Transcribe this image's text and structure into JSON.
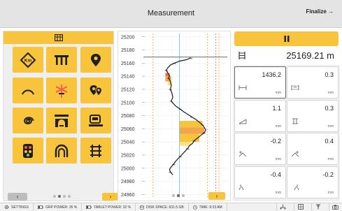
{
  "header": {
    "title": "Measurement",
    "finalize_label": "Finalize →"
  },
  "left_panel": {
    "header_icon": "grid-table-icon",
    "tiles": [
      {
        "name": "km-marker-tile",
        "icon": "km-diamond-icon",
        "text": "Km"
      },
      {
        "name": "bridge-tile",
        "icon": "bridge-icon"
      },
      {
        "name": "location-pin-tile",
        "icon": "location-pin-icon"
      },
      {
        "name": "curve-tile",
        "icon": "curve-arc-icon"
      },
      {
        "name": "level-crossing-tile",
        "icon": "level-crossing-icon"
      },
      {
        "name": "multiple-pins-tile",
        "icon": "multiple-pins-icon"
      },
      {
        "name": "spiral-tile",
        "icon": "spiral-icon"
      },
      {
        "name": "tunnel-portal-tile",
        "icon": "tunnel-portal-icon"
      },
      {
        "name": "platform-tile",
        "icon": "platform-icon"
      },
      {
        "name": "signal-tile",
        "icon": "signal-icon"
      },
      {
        "name": "tunnel-tile",
        "icon": "tunnel-arch-icon"
      },
      {
        "name": "track-tile",
        "icon": "track-ties-icon"
      }
    ],
    "prev_label": "‹",
    "next_label": "›",
    "page_dots": 4,
    "active_dot": 1
  },
  "chart_data": {
    "type": "line",
    "y_ticks": [
      "25200",
      "25180",
      "25160",
      "25140",
      "25120",
      "25100",
      "25080",
      "25060",
      "25040",
      "25020",
      "25000",
      "24980",
      "24960"
    ],
    "ylim": [
      24955,
      25205
    ],
    "x_range": [
      0,
      100
    ],
    "current_position": 25169.21,
    "series": [
      {
        "points": [
          [
            56,
            25168
          ],
          [
            50,
            25165
          ],
          [
            42,
            25163
          ],
          [
            36,
            25160
          ],
          [
            31,
            25157
          ],
          [
            28,
            25153
          ],
          [
            26,
            25149
          ],
          [
            28,
            25145
          ],
          [
            30,
            25141
          ],
          [
            29,
            25137
          ],
          [
            31,
            25132
          ],
          [
            32,
            25126
          ],
          [
            31,
            25120
          ],
          [
            33,
            25114
          ],
          [
            34,
            25108
          ],
          [
            32,
            25102
          ],
          [
            35,
            25098
          ],
          [
            38,
            25094
          ],
          [
            43,
            25090
          ],
          [
            47,
            25086
          ],
          [
            52,
            25082
          ],
          [
            57,
            25078
          ],
          [
            62,
            25074
          ],
          [
            66,
            25070
          ],
          [
            70,
            25066
          ],
          [
            72,
            25062
          ],
          [
            74,
            25058
          ],
          [
            72,
            25054
          ],
          [
            68,
            25050
          ],
          [
            64,
            25046
          ],
          [
            60,
            25042
          ],
          [
            58,
            25038
          ],
          [
            54,
            25034
          ],
          [
            52,
            25030
          ],
          [
            49,
            25026
          ],
          [
            46,
            25022
          ],
          [
            43,
            25018
          ],
          [
            40,
            25014
          ],
          [
            37,
            25010
          ],
          [
            35,
            25006
          ],
          [
            32,
            25002
          ],
          [
            30,
            24998
          ],
          [
            31,
            24994
          ],
          [
            34,
            24990
          ]
        ]
      }
    ],
    "bands": [
      {
        "y0": 25145,
        "y1": 25140,
        "x0": 25,
        "x1": 30,
        "color": "#f4694a"
      },
      {
        "y0": 25140,
        "y1": 25132,
        "x0": 25,
        "x1": 32,
        "color": "#f7a24a"
      },
      {
        "y0": 25132,
        "y1": 25126,
        "x0": 28,
        "x1": 33,
        "color": "#fbe08a"
      },
      {
        "y0": 25072,
        "y1": 25062,
        "x0": 42,
        "x1": 70,
        "color": "#f7c43c"
      },
      {
        "y0": 25062,
        "y1": 25052,
        "x0": 42,
        "x1": 72,
        "color": "#f4a54a"
      },
      {
        "y0": 25052,
        "y1": 25040,
        "x0": 42,
        "x1": 66,
        "color": "#f7c43c"
      },
      {
        "y0": 25040,
        "y1": 25034,
        "x0": 42,
        "x1": 56,
        "color": "#fbe08a"
      }
    ],
    "ref_lines": [
      {
        "x": 10,
        "color": "#f0a030"
      },
      {
        "x": 42,
        "color": "#6ec0d0"
      },
      {
        "x": 76,
        "color": "#f0a030"
      },
      {
        "x": 86,
        "color": "#f07050"
      },
      {
        "x": 90,
        "color": "#f0a030"
      }
    ],
    "grid": true,
    "next_label": "›",
    "page_dots": 3,
    "active_dot": 1
  },
  "right_panel": {
    "pause_icon": "pause-icon",
    "position_icon": "rail-track-icon",
    "position_value": "25169.21 m",
    "cards": [
      {
        "name": "gauge-card",
        "value": "1436.2",
        "unit": "mm",
        "icon": "gauge-width-icon",
        "active": true
      },
      {
        "name": "gauge-deviation-card",
        "value": "0.3",
        "unit": "mm",
        "icon": "gauge-deviation-icon",
        "active": false
      },
      {
        "name": "cant-card",
        "value": "1.1",
        "unit": "mm",
        "icon": "cant-icon",
        "active": false
      },
      {
        "name": "twist-card",
        "value": "0.3",
        "unit": "mm",
        "icon": "twist-icon",
        "active": false
      },
      {
        "name": "alignment-left-card",
        "value": "-0.2",
        "unit": "mm",
        "icon": "alignment-left-icon",
        "active": false
      },
      {
        "name": "alignment-right-card",
        "value": "0.4",
        "unit": "mm",
        "icon": "alignment-right-icon",
        "active": false
      },
      {
        "name": "level-left-card",
        "value": "-0.4",
        "unit": "mm",
        "icon": "level-left-icon",
        "active": false
      },
      {
        "name": "level-right-card",
        "value": "-0.2",
        "unit": "mm",
        "icon": "level-right-icon",
        "active": false
      }
    ]
  },
  "status_bar": {
    "settings": "SETTINGS",
    "grp_power": "GRP POWER: 35 %",
    "tablet_power": "TABLET POWER: 32 %",
    "disk_space": "DISK SPACE: 631.5 GB",
    "time": "TIME: 9:33 AM"
  },
  "colors": {
    "accent": "#f7c43c",
    "panel_bg": "#efefef",
    "topbar_bg": "#e4e4e4"
  }
}
